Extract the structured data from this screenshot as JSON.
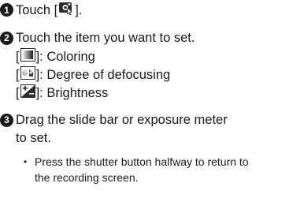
{
  "steps": [
    {
      "number": "1",
      "prefix": "Touch [",
      "suffix": "].",
      "icon": "defocus-control-touch-icon"
    },
    {
      "number": "2",
      "text": "Touch the item you want to set.",
      "items": [
        {
          "icon": "coloring-icon",
          "label": "]: Coloring"
        },
        {
          "icon": "degree-of-defocusing-icon",
          "label": "]: Degree of defocusing"
        },
        {
          "icon": "brightness-icon",
          "label": "]: Brightness"
        }
      ]
    },
    {
      "number": "3",
      "text_line1": "Drag the slide bar or exposure meter",
      "text_line2": "to set.",
      "note_bullet": "•",
      "note_line1": "Press the shutter button halfway to return to",
      "note_line2": "the recording screen."
    }
  ],
  "bracket_open": "["
}
